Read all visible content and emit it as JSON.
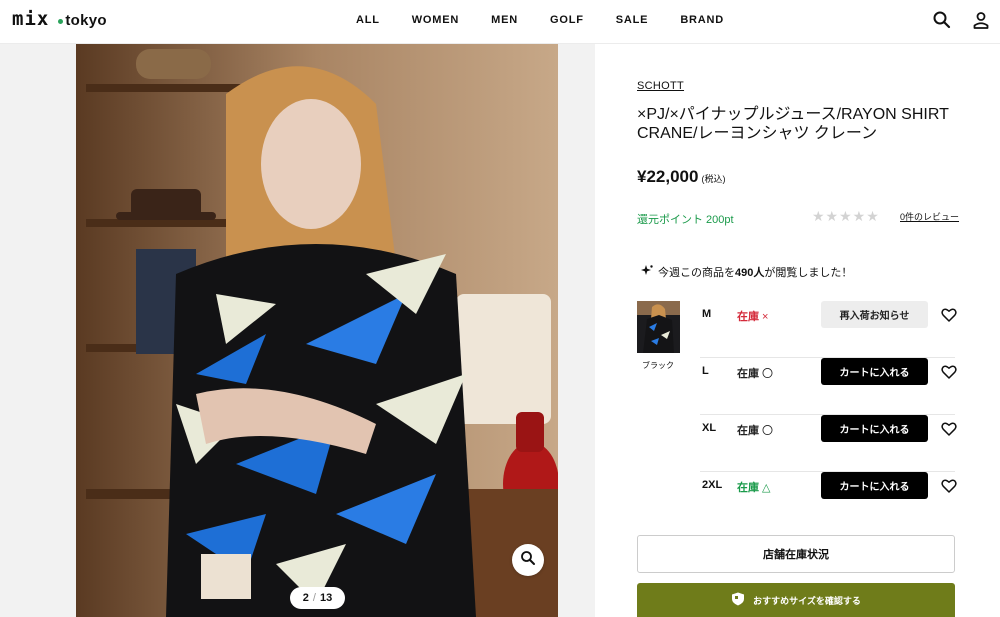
{
  "header": {
    "logo_text": "mix",
    "logo_sub": "tokyo",
    "nav": [
      "ALL",
      "WOMEN",
      "MEN",
      "GOLF",
      "SALE",
      "BRAND"
    ]
  },
  "gallery": {
    "current": "2",
    "separator": "/",
    "total": "13"
  },
  "product": {
    "brand": "SCHOTT",
    "title": "×PJ/×パイナップルジュース/RAYON SHIRT CRANE/レーヨンシャツ クレーン",
    "price": "¥22,000",
    "tax_note": "(税込)",
    "points": "還元ポイント 200pt",
    "stars": "★★★★★",
    "rating_value": 0,
    "reviews_link": "0件のレビュー",
    "viewed_pre": "今週この商品を",
    "viewed_count": "490人",
    "viewed_post": "が閲覧しました！",
    "color_name": "ブラック"
  },
  "sizes": [
    {
      "size": "M",
      "stock": "在庫",
      "mark": "×",
      "status": "out",
      "button": "再入荷お知らせ"
    },
    {
      "size": "L",
      "stock": "在庫",
      "mark": "〇",
      "status": "in",
      "button": "カートに入れる"
    },
    {
      "size": "XL",
      "stock": "在庫",
      "mark": "〇",
      "status": "in",
      "button": "カートに入れる"
    },
    {
      "size": "2XL",
      "stock": "在庫",
      "mark": "△",
      "status": "few",
      "button": "カートに入れる"
    }
  ],
  "buttons": {
    "store_stock": "店舗在庫状況",
    "recommend_size": "おすすめサイズを確認する"
  },
  "colors": {
    "accent_green": "#1a9a4a",
    "stock_red": "#d42a3a",
    "size_button_olive": "#6f7c1a"
  }
}
